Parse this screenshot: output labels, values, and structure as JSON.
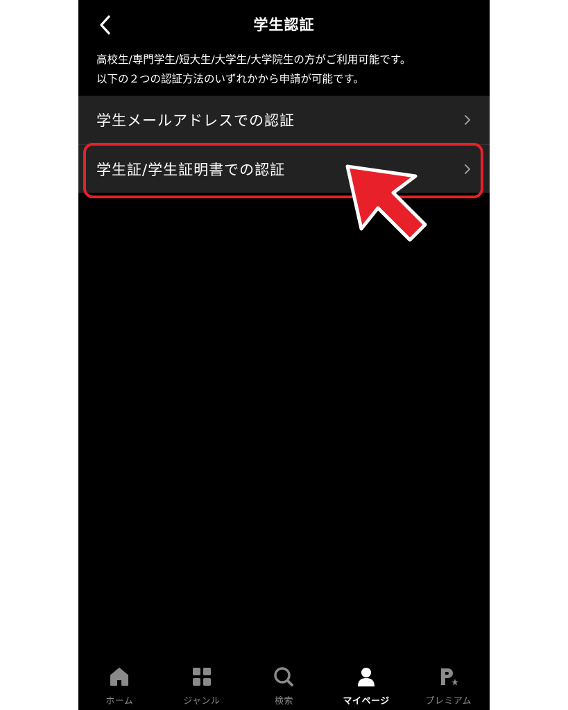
{
  "header": {
    "title": "学生認証",
    "back_icon": "chevron-left-icon"
  },
  "description": {
    "line1": "高校生/専門学生/短大生/大学生/大学院生の方がご利用可能です。",
    "line2": "以下の２つの認証方法のいずれかから申請が可能です。"
  },
  "options": [
    {
      "label": "学生メールアドレスでの認証",
      "icon": "chevron-right-icon"
    },
    {
      "label": "学生証/学生証明書での認証",
      "icon": "chevron-right-icon"
    }
  ],
  "annotation": {
    "highlight_color": "#e8202a",
    "arrow_color": "#e8202a"
  },
  "tabbar": {
    "active_tab": "マイページ",
    "tabs": [
      {
        "label": "ホーム",
        "icon": "home-icon"
      },
      {
        "label": "ジャンル",
        "icon": "grid-icon"
      },
      {
        "label": "検索",
        "icon": "search-icon"
      },
      {
        "label": "マイページ",
        "icon": "person-icon"
      },
      {
        "label": "プレミアム",
        "icon": "premium-icon"
      }
    ]
  },
  "colors": {
    "background": "#000000",
    "option_background": "#222222",
    "text": "#ffffff",
    "inactive_tab": "#8a8a8a"
  }
}
